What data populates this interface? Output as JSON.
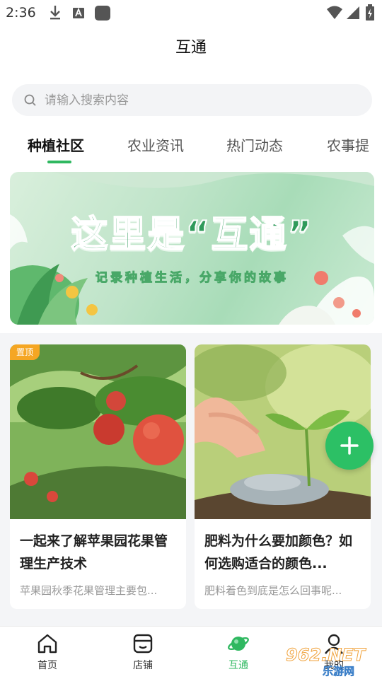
{
  "status_bar": {
    "time": "2:36"
  },
  "header": {
    "title": "互通"
  },
  "search": {
    "placeholder": "请输入搜索内容"
  },
  "tabs": [
    {
      "label": "种植社区",
      "active": true
    },
    {
      "label": "农业资讯",
      "active": false
    },
    {
      "label": "热门动态",
      "active": false
    },
    {
      "label": "农事提",
      "active": false
    }
  ],
  "banner": {
    "headline": "这里是“互通”",
    "subtitle": "记录种植生活，分享你的故事"
  },
  "posts": [
    {
      "badge": "置顶",
      "title": "一起来了解苹果园花果管理生产技术",
      "description": "苹果园秋季花果管理主要包..."
    },
    {
      "title": "肥料为什么要加颜色？如何选购适合的颜色...",
      "description": "肥料着色到底是怎么回事呢..."
    }
  ],
  "fab": {
    "icon": "plus-icon"
  },
  "bottom_nav": [
    {
      "label": "首页",
      "icon": "home-icon",
      "active": false
    },
    {
      "label": "店铺",
      "icon": "store-icon",
      "active": false
    },
    {
      "label": "互通",
      "icon": "planet-icon",
      "active": true
    },
    {
      "label": "我的",
      "icon": "profile-icon",
      "active": false
    }
  ],
  "watermark": {
    "number": "962.NET",
    "text": "乐游网"
  },
  "colors": {
    "accent": "#2fb860",
    "fab": "#2cc065",
    "badge": "#f5a623"
  }
}
